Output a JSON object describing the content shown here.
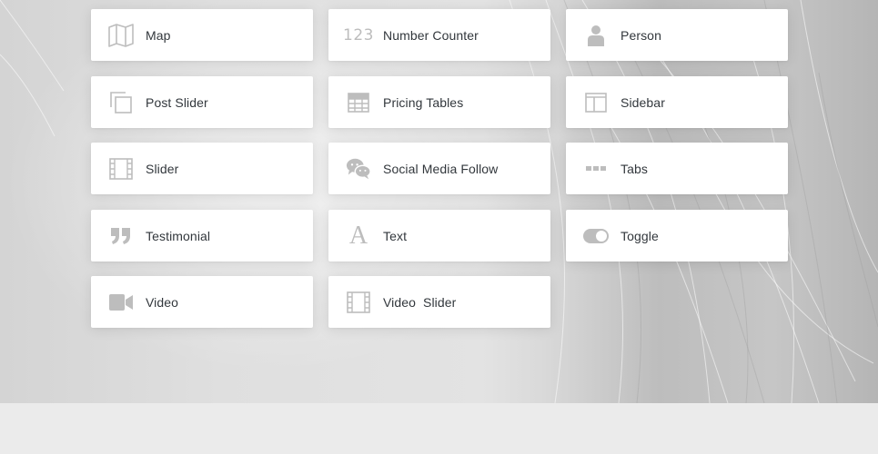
{
  "modules": [
    {
      "label": "Map",
      "icon": "map-icon"
    },
    {
      "label": "Number Counter",
      "icon": "number-counter-icon",
      "icon_text": "123"
    },
    {
      "label": "Person",
      "icon": "person-icon"
    },
    {
      "label": "Post Slider",
      "icon": "post-slider-icon"
    },
    {
      "label": "Pricing Tables",
      "icon": "pricing-tables-icon"
    },
    {
      "label": "Sidebar",
      "icon": "sidebar-icon"
    },
    {
      "label": "Slider",
      "icon": "slider-icon"
    },
    {
      "label": "Social Media Follow",
      "icon": "social-media-follow-icon"
    },
    {
      "label": "Tabs",
      "icon": "tabs-icon"
    },
    {
      "label": "Testimonial",
      "icon": "testimonial-icon"
    },
    {
      "label": "Text",
      "icon": "text-icon",
      "icon_text": "A"
    },
    {
      "label": "Toggle",
      "icon": "toggle-icon"
    },
    {
      "label": "Video",
      "icon": "video-icon"
    },
    {
      "label": "Video  Slider",
      "icon": "video-slider-icon"
    }
  ],
  "colors": {
    "icon": "#bdbdbd",
    "label": "#32373c",
    "card": "#ffffff",
    "page_bottom": "#ebebeb"
  }
}
